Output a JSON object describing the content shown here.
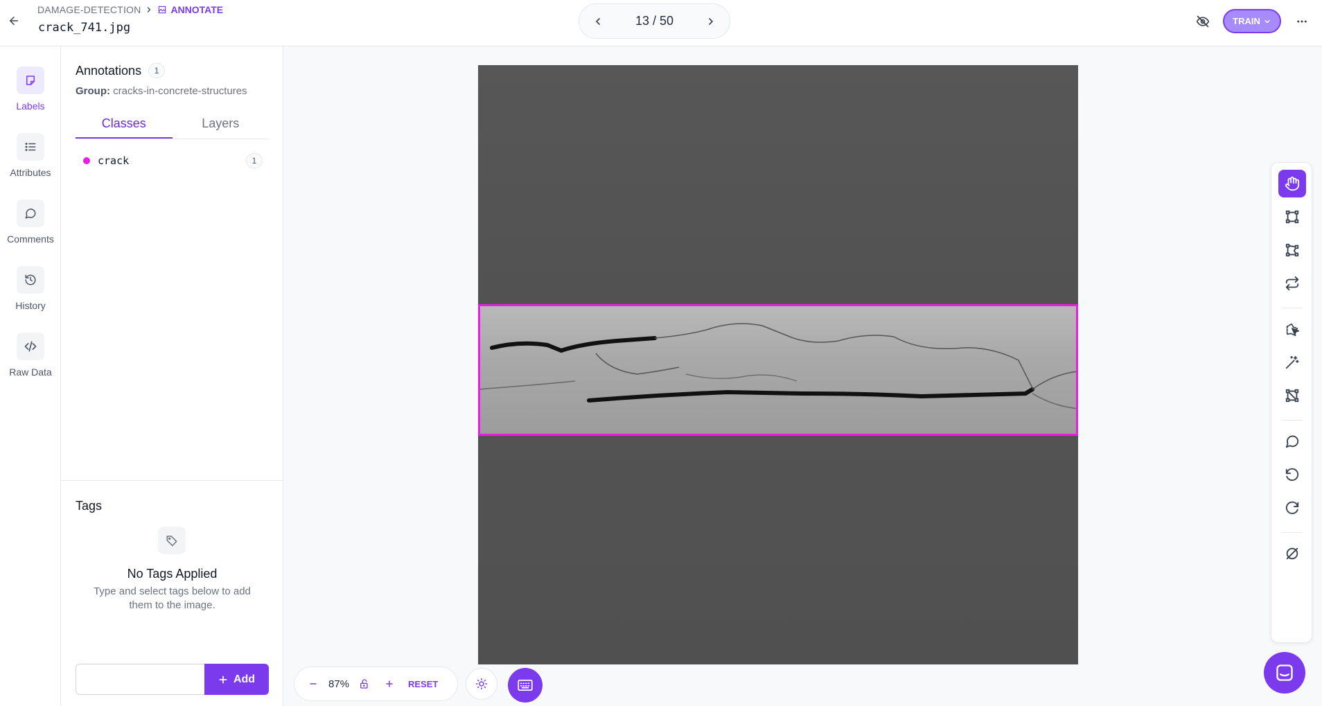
{
  "header": {
    "breadcrumb_project": "DAMAGE-DETECTION",
    "breadcrumb_page": "ANNOTATE",
    "filename": "crack_741.jpg",
    "pager_text": "13 / 50",
    "train_label": "TRAIN"
  },
  "rail": {
    "items": [
      {
        "label": "Labels",
        "icon": "labels-icon"
      },
      {
        "label": "Attributes",
        "icon": "list-icon"
      },
      {
        "label": "Comments",
        "icon": "comment-icon"
      },
      {
        "label": "History",
        "icon": "history-icon"
      },
      {
        "label": "Raw Data",
        "icon": "code-icon"
      }
    ]
  },
  "annotations": {
    "title": "Annotations",
    "count": "1",
    "group_label": "Group:",
    "group_value": "cracks-in-concrete-structures",
    "tabs": [
      "Classes",
      "Layers"
    ],
    "classes": [
      {
        "name": "crack",
        "count": "1",
        "color": "#e91ee3"
      }
    ]
  },
  "tags": {
    "title": "Tags",
    "empty_title": "No Tags Applied",
    "empty_desc": "Type and select tags below to add them to the image.",
    "input_placeholder": "",
    "add_label": "Add"
  },
  "canvas": {
    "zoom": "87%",
    "reset_label": "RESET"
  },
  "colors": {
    "accent": "#7c3aed",
    "bbox": "#e91ee3"
  }
}
